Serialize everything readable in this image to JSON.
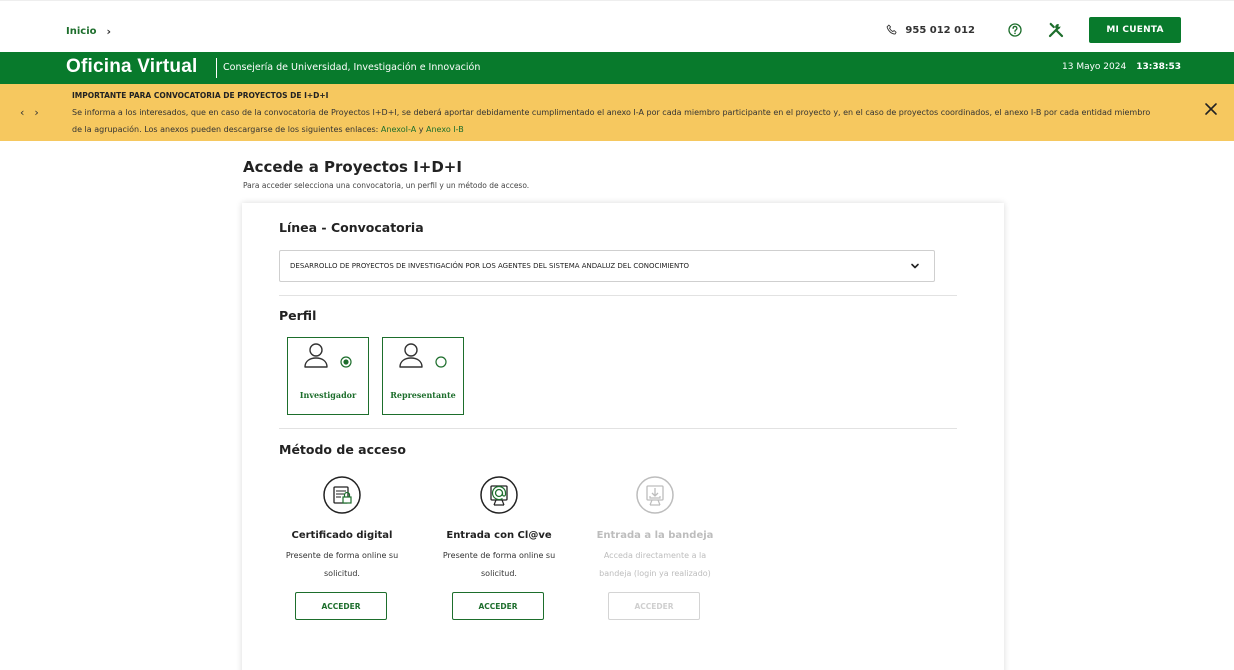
{
  "breadcrumb": {
    "home": "Inicio",
    "separator": "›"
  },
  "top": {
    "phone": "955 012 012",
    "phone_icon": "phone-icon",
    "help_icon": "help-circle-icon",
    "tools_icon": "tools-icon",
    "account_button": "MI CUENTA"
  },
  "header": {
    "brand": "Oficina Virtual",
    "subtitle": "Consejería de Universidad, Investigación e Innovación",
    "date": "13 Mayo 2024",
    "time": "13:38:53"
  },
  "notice": {
    "prev": "‹",
    "next": "›",
    "title": "IMPORTANTE PARA CONVOCATORIA DE PROYECTOS DE I+D+I",
    "text_before": "Se informa a los interesados, que en caso de la convocatoria de Proyectos I+D+I, se deberá aportar debidamente cumplimentado el anexo I-A por cada miembro participante en el proyecto y, en el caso de proyectos coordinados, el anexo I-B por cada entidad miembro de la agrupación. Los anexos pueden descargarse de los siguientes enlaces: ",
    "link_a": "AnexoI-A",
    "connector": " y ",
    "link_b": "Anexo I-B",
    "close_icon": "close-icon"
  },
  "page": {
    "title": "Accede a Proyectos I+D+I",
    "description": "Para acceder selecciona una convocatoria, un perfil y un método de acceso."
  },
  "convocatoria": {
    "title": "Línea - Convocatoria",
    "selected": "DESARROLLO DE PROYECTOS DE INVESTIGACIÓN POR LOS AGENTES DEL SISTEMA ANDALUZ DEL CONOCIMIENTO"
  },
  "perfil": {
    "title": "Perfil",
    "options": [
      {
        "label": "Investigador",
        "selected": true
      },
      {
        "label": "Representante",
        "selected": false
      }
    ]
  },
  "metodo": {
    "title": "Método de acceso",
    "methods": [
      {
        "title": "Certificado digital",
        "desc_line1": "Presente de forma online su",
        "desc_line2": "solicitud.",
        "button": "ACCEDER",
        "enabled": true,
        "icon": "certificate-icon"
      },
      {
        "title": "Entrada con Cl@ve",
        "desc_line1": "Presente de forma online su",
        "desc_line2": "solicitud.",
        "button": "ACCEDER",
        "enabled": true,
        "icon": "clave-icon"
      },
      {
        "title": "Entrada a la bandeja",
        "desc_line1": "Acceda directamente a la",
        "desc_line2": "bandeja (login ya realizado)",
        "button": "ACCEDER",
        "enabled": false,
        "icon": "tray-download-icon"
      }
    ]
  },
  "colors": {
    "green": "#087a2c",
    "link_green": "#1d6e2c",
    "notice_yellow": "#f6c85f"
  }
}
